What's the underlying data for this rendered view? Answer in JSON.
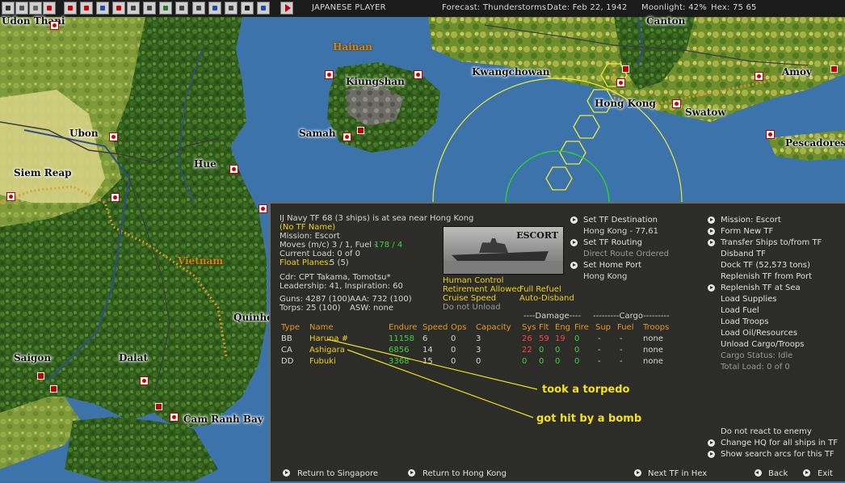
{
  "toolbar": {
    "player": "JAPANESE PLAYER",
    "forecast": "Forecast: Thunderstorms",
    "date": "Date: Feb 22, 1942",
    "moonlight": "Moonlight: 42%",
    "hex": "Hex: 75 65",
    "icons": [
      "display-options-icon",
      "map-icon",
      "mail-icon",
      "flag-japan-icon",
      "airbase-icon",
      "ground-unit-icon",
      "aircraft-icon",
      "land-unit-icon",
      "tf-flag-icon",
      "hq-icon",
      "sliders-icon",
      "info-icon",
      "planes-icon",
      "ships-icon",
      "bases-icon",
      "target-icon",
      "op-icon",
      "db-icon",
      "screen-icon",
      "end-turn-icon"
    ]
  },
  "map": {
    "places": [
      "Udon Thani",
      "Hainan",
      "Kiungshan",
      "Kwangchowan",
      "Canton",
      "Amoy",
      "Hong Kong",
      "Swatow",
      "Pescadores",
      "Samah",
      "Ubon",
      "Siem Reap",
      "Hue",
      "Vietnam",
      "Quinhon",
      "Saigon",
      "Dalat",
      "Cam Ranh Bay"
    ]
  },
  "tf": {
    "title": "IJ Navy TF 68 (3 ships) is at sea near Hong Kong",
    "subtitle": "(No TF Name)",
    "mission": "Mission: Escort",
    "moves": "Moves (m/c) 3 / 1, Fuel -",
    "fuel": "178 / 4",
    "current_load": "Current Load: 0 of 0",
    "float_planes_label": "Float Planes:",
    "float_planes_value": "5 (5)",
    "cdr": "Cdr: CPT Takama, Tomotsu*",
    "leadership": "Leadership: 41, Inspiration: 60",
    "guns": "Guns: 4287 (100)",
    "aaa": "AAA: 732 (100)",
    "torps": "Torps: 25 (100)",
    "asw": "ASW: none",
    "photo_label": "ESCORT",
    "flags": {
      "human_control": "Human Control",
      "retirement": "Retirement Allowed",
      "full_refuel": "Full Refuel",
      "cruise_speed": "Cruise Speed",
      "auto_disband": "Auto-Disband",
      "do_not_unload": "Do not Unload"
    },
    "center_actions": [
      "Set TF Destination",
      "Hong Kong - 77,61",
      "Set TF Routing",
      "Direct Route Ordered",
      "Set Home Port",
      "Hong Kong"
    ],
    "right_actions": [
      "Mission: Escort",
      "Form New TF",
      "Transfer Ships to/from TF",
      "Disband TF",
      "Dock TF (52,573 tons)",
      "Replenish TF from Port",
      "Replenish TF at Sea",
      "Load Supplies",
      "Load Fuel",
      "Load Troops",
      "Load Oil/Resources",
      "Unload Cargo/Troops",
      "Cargo Status: Idle",
      "Total Load: 0 of 0"
    ],
    "group_headers": {
      "damage": "----Damage----",
      "cargo": "---------Cargo---------"
    },
    "columns": [
      "Type",
      "Name",
      "Endure",
      "Speed",
      "Ops",
      "Capacity",
      "Sys",
      "Flt",
      "Eng",
      "Fire",
      "Sup",
      "Fuel",
      "Troops"
    ],
    "ships": [
      {
        "type": "BB",
        "name": "Haruna #",
        "endure": "11158",
        "speed": "6",
        "ops": "0",
        "capacity": "3",
        "sys": "26",
        "flt": "59",
        "eng": "19",
        "fire": "0",
        "sup": "-",
        "fuel": "-",
        "troops": "none"
      },
      {
        "type": "CA",
        "name": "Ashigara",
        "endure": "6856",
        "speed": "14",
        "ops": "0",
        "capacity": "3",
        "sys": "22",
        "flt": "0",
        "eng": "0",
        "fire": "0",
        "sup": "-",
        "fuel": "-",
        "troops": "none"
      },
      {
        "type": "DD",
        "name": "Fubuki",
        "endure": "3368",
        "speed": "15",
        "ops": "0",
        "capacity": "0",
        "sys": "0",
        "flt": "0",
        "eng": "0",
        "fire": "0",
        "sup": "-",
        "fuel": "-",
        "troops": "none"
      }
    ],
    "annotations": {
      "torpedo": "took a torpedo",
      "bomb": "got hit by a bomb"
    },
    "lower_right": [
      "Do not react to enemy",
      "Change HQ for all ships in TF",
      "Show search arcs for this TF"
    ],
    "bottom": {
      "return_singapore": "Return to Singapore",
      "return_hongkong": "Return to Hong Kong",
      "next_tf": "Next TF in Hex",
      "back": "Back",
      "exit": "Exit"
    }
  },
  "colors": {
    "panel_bg": "#2c2c28",
    "yellow": "#f2d21a",
    "green": "#3fd23f",
    "red": "#ff4545",
    "orange_header": "#e39a2a",
    "sea": "#3a6fa6"
  }
}
